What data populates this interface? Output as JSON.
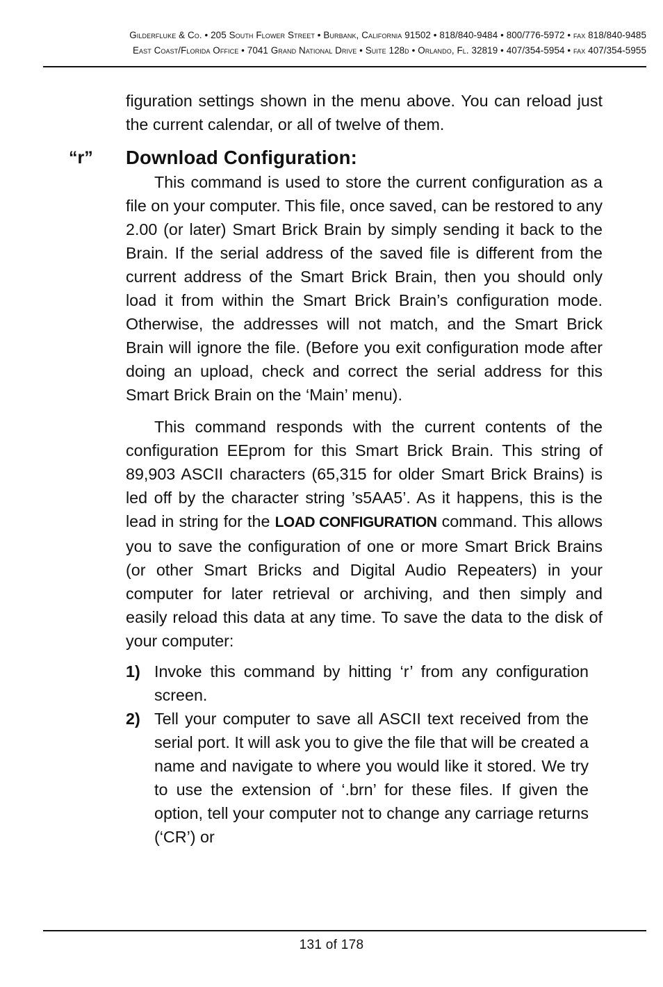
{
  "header": {
    "line1": {
      "company": "Gilderfluke & Co.",
      "address": "205 South Flower Street",
      "city": "Burbank, California",
      "zip": "91502",
      "phone1": "818/840-9484",
      "phone2": "800/776-5972",
      "fax_label": "fax",
      "fax": "818/840-9485"
    },
    "line2": {
      "office": "East Coast/Florida Office",
      "address": "7041 Grand National Drive",
      "suite": "Suite 128d",
      "city": "Orlando, Fl.",
      "zip": "32819",
      "phone": "407/354-5954",
      "fax_label": "fax",
      "fax": "407/354-5955"
    },
    "separator": " • "
  },
  "content": {
    "intro": "figuration settings shown in the menu above. You can reload just the current calendar, or all of twelve of them.",
    "section": {
      "key": "“r”",
      "title": "Download Configuration:",
      "paragraph1": "This command is used to store the current configuration as a file on your computer. This file, once saved, can be restored to any 2.00 (or later) Smart Brick Brain by simply sending it back to the Brain. If the serial address of the saved file is different from the current address of the Smart Brick Brain, then you should only load it from within the Smart Brick Brain’s configuration mode. Otherwise, the addresses will not match, and the Smart Brick Brain will ignore the file. (Before you exit configuration mode after doing an upload, check and correct the serial address for this Smart Brick Brain on the ‘Main’ menu).",
      "paragraph2_before": "This command responds with the current contents of the configuration EEprom for this Smart Brick Brain. This string of 89,903 ASCII characters (65,315 for older Smart Brick Brains) is led off by the character string ’s5AA5’. As it happens, this is the lead in string for the ",
      "paragraph2_bold": "LOAD CONFIGURATION",
      "paragraph2_after": " command. This allows you to save the configuration of one or more Smart Brick Brains (or other Smart Bricks and Digital Audio Repeaters) in your computer for later retrieval or archiving, and then simply and easily reload this data at any time. To save the data to the disk of your computer:",
      "steps": [
        {
          "num": "1)",
          "text": "Invoke this command by hitting ‘r’ from any configuration screen."
        },
        {
          "num": "2)",
          "text": "Tell your computer to save all ASCII text received from the serial port. It will ask you to give the file that will be created a name and navigate to where you would like it stored. We try to use the extension of ‘.brn’ for these files. If given the option, tell your computer not to change any carriage returns (‘CR’) or"
        }
      ]
    }
  },
  "footer": {
    "page_label": "131 of 178"
  }
}
